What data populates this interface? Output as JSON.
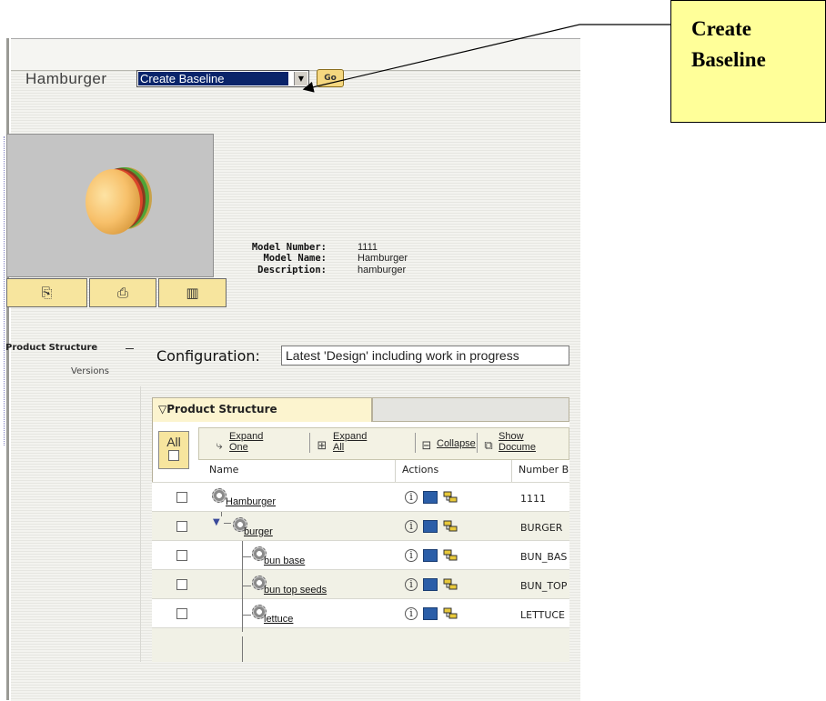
{
  "header": {
    "model_title": "Hamburger",
    "action_select_value": "Create Baseline",
    "go_label": "Go"
  },
  "model_info": {
    "model_number_label": "Model Number:",
    "model_number": "1111",
    "model_name_label": "Model Name:",
    "model_name": "Hamburger",
    "description_label": "Description:",
    "description": "hamburger"
  },
  "thumbnail_buttons": [
    {
      "icon": "copy-icon"
    },
    {
      "icon": "print-icon"
    },
    {
      "icon": "window-icon"
    }
  ],
  "side": {
    "product_structure": "Product Structure",
    "versions": "Versions"
  },
  "configuration": {
    "label": "Configuration:",
    "value": "Latest 'Design' including work in progress"
  },
  "panel": {
    "tab_label": "Product Structure",
    "all_label": "All",
    "toolbar": {
      "expand_one_1": "Expand",
      "expand_one_2": "One",
      "expand_all_1": "Expand",
      "expand_all_2": "All",
      "collapse": "Collapse",
      "show_docs_1": "Show",
      "show_docs_2": "Docume"
    },
    "columns": {
      "name": "Name",
      "actions": "Actions",
      "number": "Number B"
    },
    "rows": [
      {
        "name": "Hamburger",
        "number": "1111"
      },
      {
        "name": "burger",
        "number": "BURGER"
      },
      {
        "name": "bun base",
        "number": "BUN_BAS"
      },
      {
        "name": "bun top seeds",
        "number": "BUN_TOP"
      },
      {
        "name": "lettuce",
        "number": "LETTUCE"
      }
    ]
  },
  "callout": {
    "line1": "Create",
    "line2": "Baseline"
  },
  "colors": {
    "callout_bg": "#ffff99",
    "select_highlight": "#0a246a",
    "button_tan": "#f7e59e",
    "go_button": "#f5d77f"
  }
}
